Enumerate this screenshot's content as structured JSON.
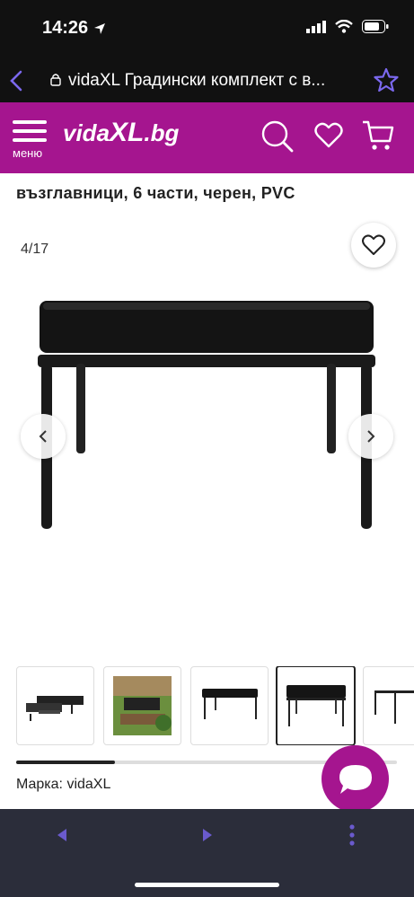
{
  "status_bar": {
    "time": "14:26"
  },
  "browser": {
    "url_title": "vidaXL Градински комплект с в..."
  },
  "header": {
    "menu_label": "меню",
    "logo_text_1": "vida",
    "logo_text_2": "XL",
    "logo_text_3": ".bg"
  },
  "product": {
    "title_line": "възглавници, 6 части, черен, PVC",
    "image_counter": "4/17",
    "brand_line": "Марка: vidaXL"
  },
  "gallery": {
    "scroll_progress": 0.26,
    "active_index": 3
  },
  "colors": {
    "brand_purple": "#a5158f",
    "bottom_bar": "#2b2d3a",
    "nav_arrow": "#6a5acd"
  },
  "icons": [
    "location-arrow-icon",
    "signal-icon",
    "wifi-icon",
    "battery-icon",
    "back-chevron-icon",
    "lock-icon",
    "star-icon",
    "hamburger-icon",
    "search-icon",
    "heart-icon",
    "cart-icon",
    "chevron-left-icon",
    "chevron-right-icon",
    "chat-icon",
    "kebab-icon"
  ]
}
